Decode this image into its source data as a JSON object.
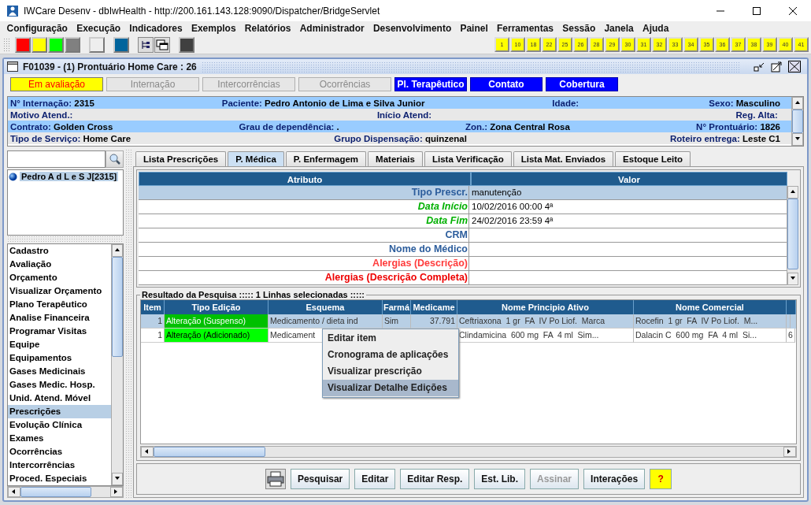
{
  "window": {
    "title": "IWCare Desenv - dbIwHealth - http://200.161.143.128:9090/Dispatcher/BridgeServlet"
  },
  "menu": [
    "Configuração",
    "Execução",
    "Indicadores",
    "Exemplos",
    "Relatórios",
    "Administrador",
    "Desenvolvimento",
    "Painel",
    "Ferramentas",
    "Sessão",
    "Janela",
    "Ajuda"
  ],
  "toolbar": {
    "swatches": [
      {
        "color": "#ff0000"
      },
      {
        "color": "#ffff00"
      },
      {
        "color": "#00ff00"
      },
      {
        "color": "#808080"
      },
      {
        "color": "#eeeeee"
      },
      {
        "color": "#00649c"
      }
    ],
    "swatches_end": [
      {
        "color": "#404040"
      }
    ],
    "numbers": [
      "1",
      "10",
      "18",
      "22",
      "25",
      "26",
      "28",
      "29",
      "30",
      "31",
      "32",
      "33",
      "34",
      "35",
      "36",
      "37",
      "38",
      "39",
      "40",
      "41"
    ]
  },
  "frame": {
    "title": "F01039 - (1) Prontuário Home Care : 26"
  },
  "status_buttons": [
    {
      "label": "Em avaliação",
      "kind": "alert"
    },
    {
      "label": "Internação",
      "kind": "disabled"
    },
    {
      "label": "Intercorrências",
      "kind": "disabled"
    },
    {
      "label": "Ocorrências",
      "kind": "disabled"
    },
    {
      "label": "Pl. Terapêutico",
      "kind": "active"
    },
    {
      "label": "Contato",
      "kind": "active"
    },
    {
      "label": "Cobertura",
      "kind": "active"
    }
  ],
  "info": [
    [
      {
        "label": "N° Internação:",
        "value": "2315"
      },
      {
        "label": "Paciente:",
        "value": "Pedro Antonio de Lima e Silva Junior"
      },
      {
        "label": "Idade:"
      },
      {
        "label": "Sexo:",
        "value": "Masculino"
      }
    ],
    [
      {
        "label": "Motivo Atend.:"
      },
      {
        "label": "Início Atend:"
      },
      {
        "label": "Reg. Alta:"
      }
    ],
    [
      {
        "label": "Contrato:",
        "value": "Golden Cross"
      },
      {
        "label": "Grau de dependência:",
        "value": "."
      },
      {
        "label": "Zon.:",
        "value": "Zona Central Rosa"
      },
      {
        "label": "N° Prontuário:",
        "value": "1826"
      }
    ],
    [
      {
        "label": "Tipo de Serviço:",
        "value": "Home Care"
      },
      {
        "label": "Grupo Dispensação:",
        "value": "quinzenal"
      },
      {
        "label": "Roteiro entrega:",
        "value": "Leste C1"
      }
    ]
  ],
  "patients": [
    {
      "name": "Pedro A d L e S J[2315]",
      "selected": true
    }
  ],
  "nav": [
    {
      "label": "Cadastro",
      "selected": false
    },
    {
      "label": "Avaliação",
      "selected": false
    },
    {
      "label": "Orçamento",
      "selected": false
    },
    {
      "label": "Visualizar Orçamento",
      "selected": false
    },
    {
      "label": "Plano Terapêutico",
      "selected": false
    },
    {
      "label": "Analise Financeira",
      "selected": false
    },
    {
      "label": "Programar Visitas",
      "selected": false
    },
    {
      "label": "Equipe",
      "selected": false
    },
    {
      "label": "Equipamentos",
      "selected": false
    },
    {
      "label": "Gases Medicinais",
      "selected": false
    },
    {
      "label": "Gases Medic. Hosp.",
      "selected": false
    },
    {
      "label": "Unid. Atend. Móvel",
      "selected": false
    },
    {
      "label": "Prescrições",
      "selected": true
    },
    {
      "label": "Evolução Clínica",
      "selected": false
    },
    {
      "label": "Exames",
      "selected": false
    },
    {
      "label": "Ocorrências",
      "selected": false
    },
    {
      "label": "Intercorrências",
      "selected": false
    },
    {
      "label": "Proced. Especiais",
      "selected": false
    }
  ],
  "tabs": [
    {
      "label": "Lista Prescrições",
      "selected": false
    },
    {
      "label": "P. Médica",
      "selected": true
    },
    {
      "label": "P. Enfermagem",
      "selected": false
    },
    {
      "label": "Materiais",
      "selected": false
    },
    {
      "label": "Lista Verificação",
      "selected": false
    },
    {
      "label": "Lista Mat. Enviados",
      "selected": false
    },
    {
      "label": "Estoque Leito",
      "selected": false
    }
  ],
  "attributes": {
    "columns": [
      "Atributo",
      "Valor"
    ],
    "rows": [
      {
        "label": "Tipo Prescr.",
        "value": "manutenção",
        "kind": "field",
        "selected": true
      },
      {
        "label": "Data Início",
        "value": "10/02/2016 00:00 4ª",
        "kind": "date",
        "selected": false
      },
      {
        "label": "Data Fim",
        "value": "24/02/2016 23:59 4ª",
        "kind": "date",
        "selected": false
      },
      {
        "label": "CRM",
        "kind": "field",
        "selected": false
      },
      {
        "label": "Nome do Médico",
        "kind": "field",
        "selected": false
      },
      {
        "label": "Alergias (Descrição)",
        "kind": "allergy",
        "selected": false
      },
      {
        "label": "Alergias (Descrição Completa)",
        "kind": "allergy-full",
        "selected": false
      }
    ]
  },
  "results": {
    "title": "Resultado da Pesquisa ::::: 1 Linhas selecionadas :::::",
    "columns": [
      "Item",
      "Tipo Edição",
      "Esquema",
      "Farmá",
      "Medicame",
      "Nome Principio Ativo",
      "Nome Comercial"
    ],
    "rows": [
      {
        "item": "1",
        "tipo": "Alteração (Suspenso)",
        "color": "#00c000",
        "esquema": "Medicamento / dieta ind",
        "farma": "Sim",
        "medicamento": "37.791",
        "principio": "Ceftriaxona  1 gr  FA  IV Po Liof.  Marca",
        "comercial": "Rocefin  1 gr  FA  IV Po Liof.  M...",
        "selected": true
      },
      {
        "item": "1",
        "tipo": "Alteração (Adicionado)",
        "color": "#00ff00",
        "esquema": "Medicament",
        "principio": "Clindamicina  600 mg  FA  4 ml  Sim...",
        "comercial": "Dalacin C  600 mg  FA  4 ml  Si...",
        "column_8": "6",
        "selected": false
      }
    ]
  },
  "context_menu": [
    {
      "label": "Editar item",
      "selected": false
    },
    {
      "label": "Cronograma de aplicações",
      "selected": false
    },
    {
      "label": "Visualizar prescrição",
      "selected": false
    },
    {
      "label": "Visualizar Detalhe Edições",
      "selected": true
    }
  ],
  "actions": [
    {
      "label": "Pesquisar",
      "disabled": false,
      "kind": "normal"
    },
    {
      "label": "Editar",
      "disabled": false,
      "kind": "normal"
    },
    {
      "label": "Editar Resp.",
      "disabled": false,
      "kind": "normal"
    },
    {
      "label": "Est. Lib.",
      "disabled": false,
      "kind": "normal"
    },
    {
      "label": "Assinar",
      "disabled": true,
      "kind": "normal"
    },
    {
      "label": "Interações",
      "disabled": false,
      "kind": "normal"
    },
    {
      "label": "?",
      "disabled": false,
      "kind": "help"
    }
  ]
}
